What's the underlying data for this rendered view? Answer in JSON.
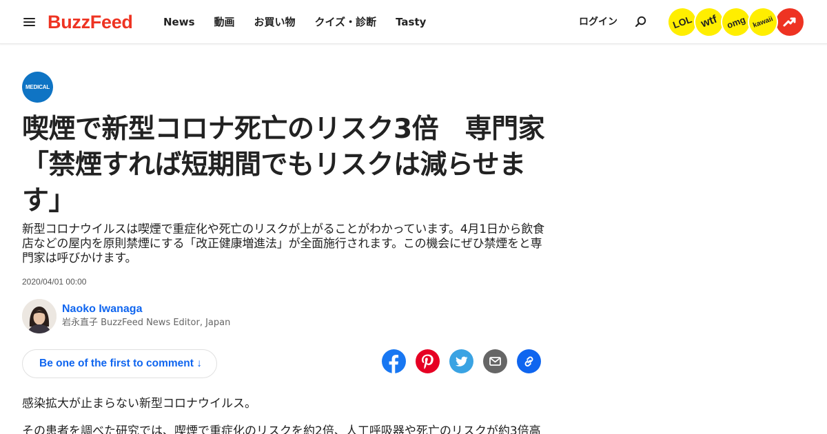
{
  "header": {
    "logo": "BuzzFeed",
    "nav": [
      "News",
      "動画",
      "お買い物",
      "クイズ・診断",
      "Tasty"
    ],
    "login": "ログイン",
    "badges": [
      "LOL",
      "wtf",
      "omg",
      "kawaii"
    ]
  },
  "article": {
    "category": "MEDICAL",
    "headline": "喫煙で新型コロナ死亡のリスク3倍　専門家「禁煙すれば短期間でもリスクは減らせます」",
    "dek": "新型コロナウイルスは喫煙で重症化や死亡のリスクが上がることがわかっています。4月1日から飲食店などの屋内を原則禁煙にする「改正健康増進法」が全面施行されます。この機会にぜひ禁煙をと専門家は呼びかけます。",
    "timestamp": "2020/04/01 00:00",
    "author_name": "Naoko Iwanaga",
    "author_role": "岩永直子 BuzzFeed News Editor, Japan",
    "comment_button": "Be one of the first to comment ↓",
    "paragraph_1": "感染拡大が止まらない新型コロナウイルス。",
    "paragraph_2": "その患者を調べた研究では、喫煙で重症化のリスクを約2倍、人工呼吸器や死亡のリスクが約3倍高"
  },
  "colors": {
    "brand": "#ee3322",
    "link": "#0f65ef",
    "medical": "#0f74c4",
    "badge_yellow": "#ffee00",
    "facebook": "#1877f2",
    "pinterest": "#e60023",
    "twitter": "#1da1f2",
    "email": "#666666",
    "copy_link": "#0f65ef"
  },
  "icons": [
    "hamburger-menu-icon",
    "search-icon",
    "trending-icon",
    "facebook-icon",
    "pinterest-icon",
    "twitter-icon",
    "email-icon",
    "link-icon"
  ]
}
